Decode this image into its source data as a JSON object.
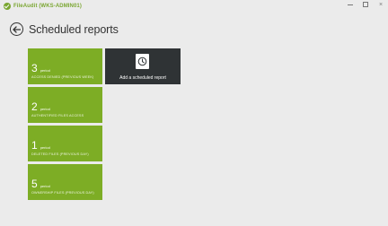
{
  "app": {
    "title": "FileAudit (WKS-ADMIN01)",
    "accent": "#7aa631",
    "controls": {
      "minimize": "minimize-icon",
      "restore": "restore-icon",
      "close": "×"
    }
  },
  "page": {
    "title": "Scheduled reports"
  },
  "reports": [
    {
      "count": "3",
      "unit": "period",
      "description": "ACCESS DENIED (PREVIOUS WEEK)"
    },
    {
      "count": "2",
      "unit": "period",
      "description": "AUTHENTIFIED FILES ACCESS"
    },
    {
      "count": "1",
      "unit": "period",
      "description": "DELETED FILES (PREVIOUS DAY)"
    },
    {
      "count": "5",
      "unit": "period",
      "description": "OWNERSHIP FILES (PREVIOUS DAY)"
    }
  ],
  "add_tile": {
    "label": "Add a scheduled report",
    "icon": "clock-icon"
  },
  "colors": {
    "tile_green": "#7dad25",
    "tile_dark": "#2f3335",
    "background": "#ebebeb"
  }
}
